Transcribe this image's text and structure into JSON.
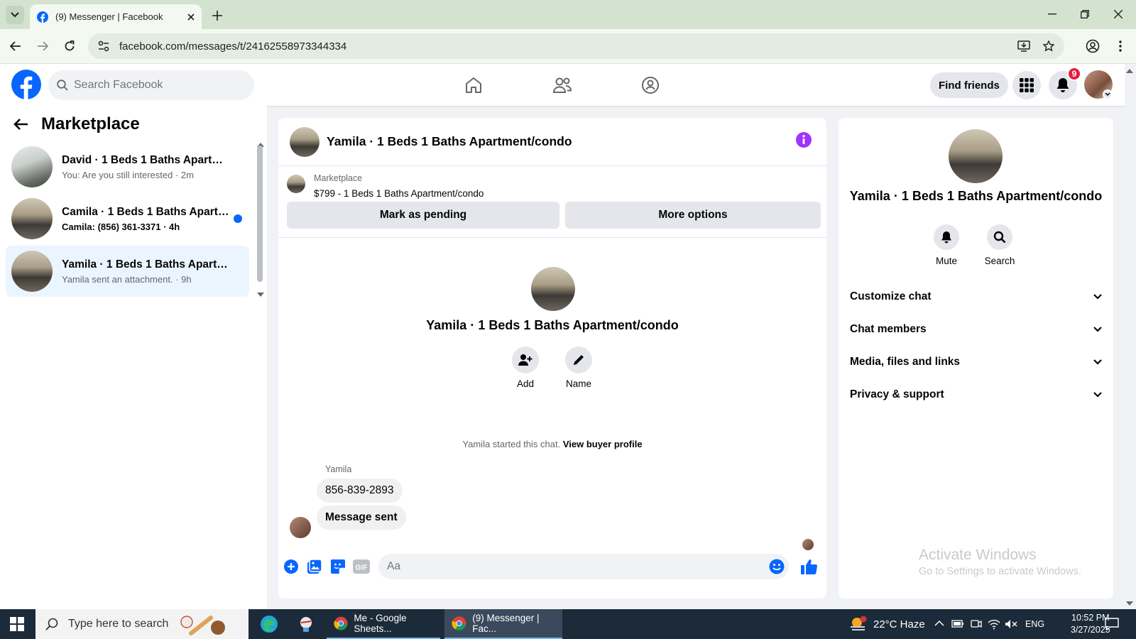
{
  "browser": {
    "tab_title": "(9) Messenger | Facebook",
    "url": "facebook.com/messages/t/24162558973344334"
  },
  "fb_header": {
    "search_placeholder": "Search Facebook",
    "find_friends": "Find friends",
    "notification_count": "9"
  },
  "left_panel": {
    "title": "Marketplace",
    "conversations": [
      {
        "name": "David · 1 Beds 1 Baths Apartmen...",
        "preview": "You: Are you still interested · 2m",
        "unread": false,
        "active": false
      },
      {
        "name": "Camila · 1 Beds 1 Baths Apartm...",
        "preview": "Camila: (856) 361-3371 · 4h",
        "unread": true,
        "active": false
      },
      {
        "name": "Yamila · 1 Beds 1 Baths Apartme...",
        "preview": "Yamila sent an attachment. · 9h",
        "unread": false,
        "active": true
      }
    ]
  },
  "chat": {
    "title": "Yamila · 1 Beds 1 Baths Apartment/condo",
    "marketplace_label": "Marketplace",
    "listing": "$799 - 1 Beds 1 Baths Apartment/condo",
    "mark_pending": "Mark as pending",
    "more_options": "More options",
    "center_name": "Yamila · 1 Beds 1 Baths Apartment/condo",
    "add_label": "Add",
    "name_label": "Name",
    "started_text": "Yamila started this chat.",
    "view_profile": "View buyer profile",
    "sender": "Yamila",
    "messages": [
      "856-839-2893",
      "Message sent"
    ],
    "input_placeholder": "Aa"
  },
  "right_panel": {
    "name": "Yamila · 1 Beds 1 Baths Apartment/condo",
    "mute": "Mute",
    "search": "Search",
    "sections": [
      "Customize chat",
      "Chat members",
      "Media, files and links",
      "Privacy & support"
    ]
  },
  "watermark": {
    "line1": "Activate Windows",
    "line2": "Go to Settings to activate Windows."
  },
  "taskbar": {
    "search_placeholder": "Type here to search",
    "app_sheets": "Me - Google Sheets...",
    "app_messenger": "(9) Messenger | Fac...",
    "weather": "22°C  Haze",
    "lang": "ENG",
    "time": "10:52 PM",
    "date": "3/27/2025"
  },
  "colors": {
    "fb_blue": "#0866ff",
    "messenger_purple": "#a033ff",
    "badge_red": "#e41e3f"
  }
}
